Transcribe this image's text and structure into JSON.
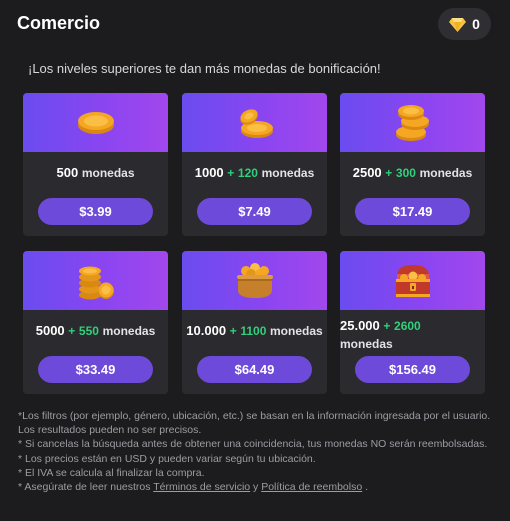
{
  "header": {
    "title": "Comercio",
    "balance": "0"
  },
  "subtitle": "¡Los niveles superiores te dan más monedas de bonificación!",
  "cards": [
    {
      "base": "500",
      "bonus": "",
      "unit": "monedas",
      "price": "$3.99",
      "icon": "single-coin-icon"
    },
    {
      "base": "1000",
      "bonus": "120",
      "unit": "monedas",
      "price": "$7.49",
      "icon": "two-coins-icon"
    },
    {
      "base": "2500",
      "bonus": "300",
      "unit": "monedas",
      "price": "$17.49",
      "icon": "coin-stack-icon"
    },
    {
      "base": "5000",
      "bonus": "550",
      "unit": "monedas",
      "price": "$33.49",
      "icon": "coin-pile-icon"
    },
    {
      "base": "10.000",
      "bonus": "1100",
      "unit": "monedas",
      "price": "$64.49",
      "icon": "coin-pot-icon"
    },
    {
      "base": "25.000",
      "bonus": "2600",
      "unit": "monedas",
      "price": "$156.49",
      "icon": "treasure-chest-icon"
    }
  ],
  "plus": "+",
  "notes": {
    "line1": "*Los filtros (por ejemplo, género, ubicación, etc.) se basan en la información ingresada por el usuario. Los resultados pueden no ser precisos.",
    "line2": "* Si cancelas la búsqueda antes de obtener una coincidencia, tus monedas NO serán reembolsadas.",
    "line3": "* Los precios están en USD y pueden variar según tu ubicación.",
    "line4": "* El IVA se calcula al finalizar la compra.",
    "line5_prefix": "* Asegúrate de leer nuestros",
    "terms_link": "Términos de servicio",
    "and": "y",
    "refund_link": "Política de reembolso",
    "line5_suffix": "."
  },
  "colors": {
    "accent": "#6d4ad9",
    "bonus": "#2fd17a",
    "gem": "#f6c343",
    "coin": "#f5a623"
  }
}
